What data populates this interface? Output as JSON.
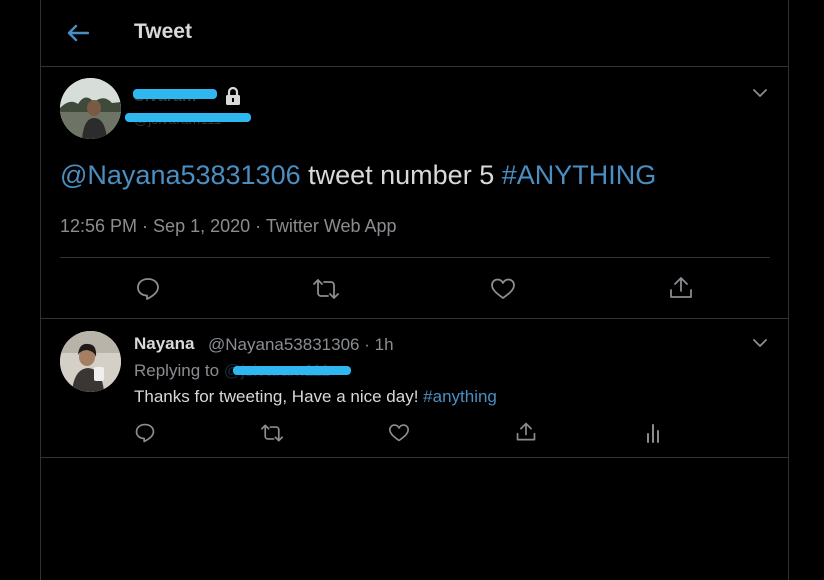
{
  "header": {
    "title": "Tweet"
  },
  "tweet": {
    "author_name": "Sivaram",
    "author_handle": "@jsivaram111",
    "mention": "@Nayana53831306",
    "body": " tweet number 5 ",
    "hashtag": "#ANYTHING",
    "time": "12:56 PM",
    "date": "Sep 1, 2020",
    "source": "Twitter Web App",
    "separator": " · "
  },
  "reply": {
    "author_name": "Nayana",
    "author_handle": "@Nayana53831306",
    "age": "1h",
    "separator": " · ",
    "replying_to_label": "Replying to",
    "replying_to_handle": "@jsivaram111",
    "body": "Thanks for tweeting, Have a nice day! ",
    "hashtag": "#anything"
  },
  "colors": {
    "background": "#000000",
    "text": "#d9d9d9",
    "secondary": "#8a8d91",
    "link": "#4a8ec2",
    "border": "#2f3336",
    "redaction": "#2fb8f0"
  }
}
